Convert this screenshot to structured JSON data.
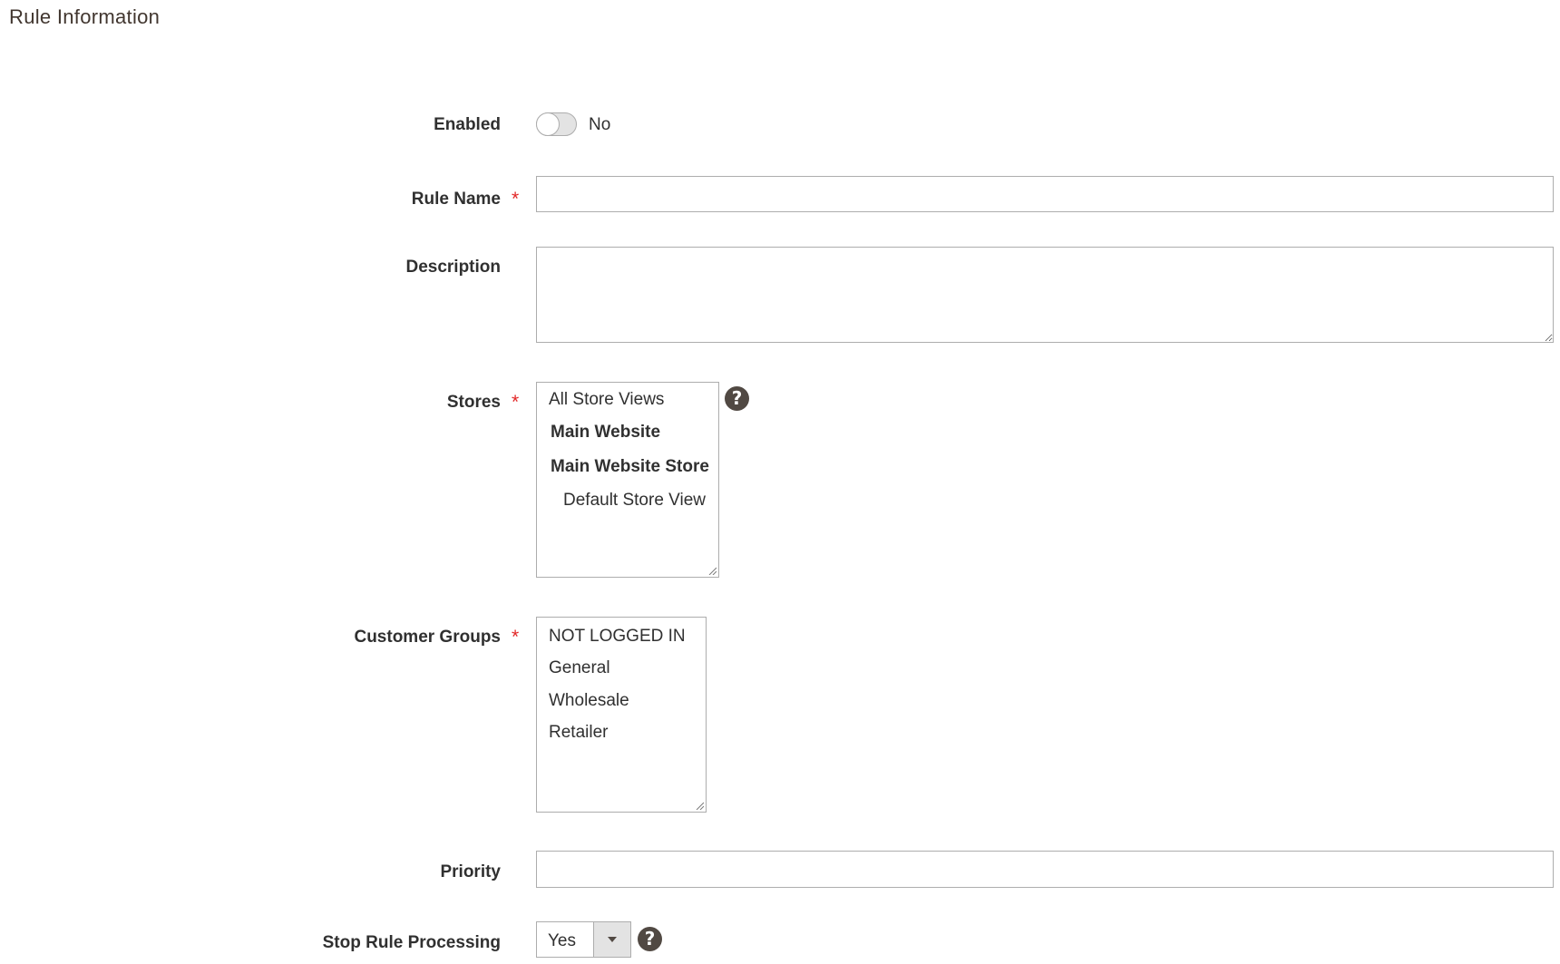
{
  "section": {
    "title": "Rule Information"
  },
  "enabled": {
    "label": "Enabled",
    "state_text": "No",
    "checked": false
  },
  "rule_name": {
    "label": "Rule Name",
    "required_mark": "*",
    "value": ""
  },
  "description": {
    "label": "Description",
    "value": ""
  },
  "stores": {
    "label": "Stores",
    "required_mark": "*",
    "help_icon": "question-circle-icon",
    "help_glyph": "?",
    "options": [
      {
        "text": "All Store Views",
        "kind": "option"
      },
      {
        "text": "Main Website",
        "kind": "group"
      },
      {
        "text": "Main Website Store",
        "kind": "group"
      },
      {
        "text": "Default Store View",
        "kind": "indent"
      }
    ]
  },
  "customer_groups": {
    "label": "Customer Groups",
    "required_mark": "*",
    "options": [
      "NOT LOGGED IN",
      "General",
      "Wholesale",
      "Retailer"
    ]
  },
  "priority": {
    "label": "Priority",
    "value": ""
  },
  "stop_rule_processing": {
    "label": "Stop Rule Processing",
    "value": "Yes",
    "help_icon": "question-circle-icon",
    "help_glyph": "?"
  },
  "colors": {
    "required": "#e22626",
    "border": "#adadad",
    "icon_bg": "#514943",
    "title": "#41362f"
  }
}
